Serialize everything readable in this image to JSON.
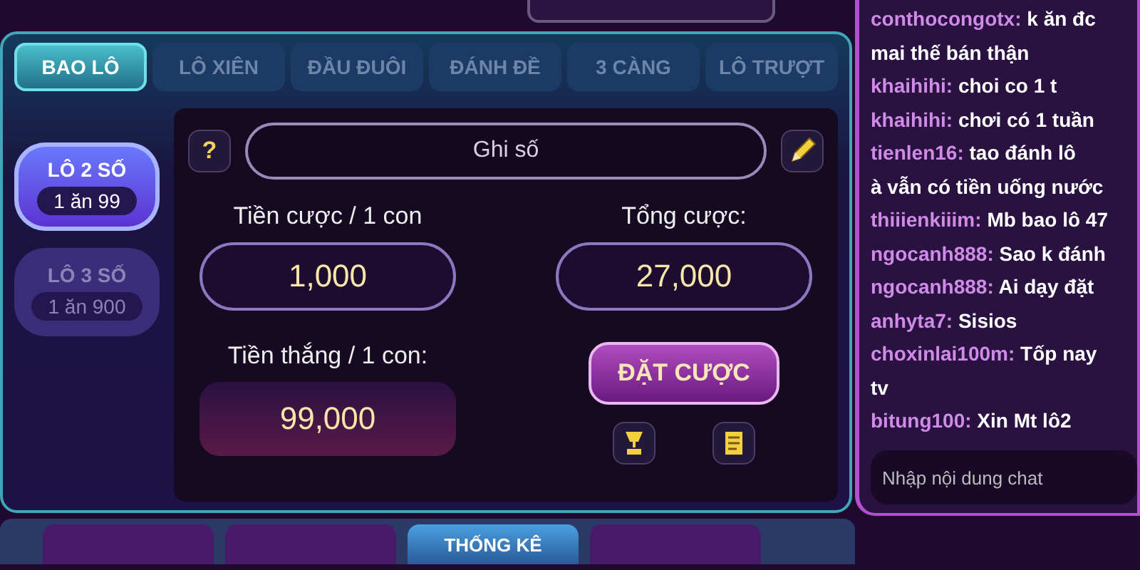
{
  "tabs": [
    {
      "label": "BAO LÔ",
      "selected": true
    },
    {
      "label": "LÔ XIÊN",
      "selected": false
    },
    {
      "label": "ĐẦU ĐUÔI",
      "selected": false
    },
    {
      "label": "ĐÁNH ĐỀ",
      "selected": false
    },
    {
      "label": "3 CÀNG",
      "selected": false
    },
    {
      "label": "LÔ TRƯỢT",
      "selected": false
    }
  ],
  "bet_types": [
    {
      "label": "LÔ 2 SỐ",
      "odds": "1 ăn 99",
      "selected": true
    },
    {
      "label": "LÔ 3 SỐ",
      "odds": "1 ăn 900",
      "selected": false
    }
  ],
  "help": "?",
  "number_field": {
    "placeholder": "Ghi số"
  },
  "stake": {
    "label": "Tiền cược / 1 con",
    "value": "1,000"
  },
  "total": {
    "label": "Tổng cược:",
    "value": "27,000"
  },
  "win": {
    "label": "Tiền thắng / 1 con:",
    "value": "99,000"
  },
  "bet_button": "ĐẶT CƯỢC",
  "bottom_bar": {
    "stats_button": "THỐNG KÊ"
  },
  "chat": {
    "messages": [
      {
        "user": "conthocongotx:",
        "lines": [
          "k ăn đc",
          "mai thế bán thận"
        ]
      },
      {
        "user": "khaihihi:",
        "lines": [
          "choi co 1 t"
        ]
      },
      {
        "user": "khaihihi:",
        "lines": [
          "chơi có 1 tuần"
        ]
      },
      {
        "user": "tienlen16:",
        "lines": [
          "tao đánh lô",
          "à vẫn có tiền uống nước"
        ]
      },
      {
        "user": "thiiienkiiim:",
        "lines": [
          "Mb bao lô 47"
        ]
      },
      {
        "user": "ngocanh888:",
        "lines": [
          "Sao k đánh"
        ]
      },
      {
        "user": "ngocanh888:",
        "lines": [
          "Ai dạy đặt"
        ]
      },
      {
        "user": "anhyta7:",
        "lines": [
          "Sisios"
        ]
      },
      {
        "user": "choxinlai100m:",
        "lines": [
          "Tốp nay",
          "tv"
        ]
      },
      {
        "user": "bitung100:",
        "lines": [
          "Xin Mt lô2"
        ]
      }
    ],
    "input": {
      "placeholder": "Nhập nội dung chat"
    }
  }
}
